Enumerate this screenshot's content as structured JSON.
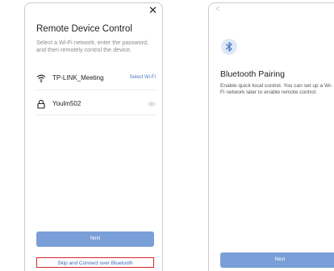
{
  "remote_control": {
    "close_icon": "close-icon",
    "title": "Remote Device Control",
    "description": "Select a Wi-Fi network, enter the password, and then remotely control the device.",
    "wifi": {
      "icon": "wifi-icon",
      "ssid": "TP-LINK_Meeting",
      "action": "Select Wi-Fi"
    },
    "password": {
      "icon": "lock-icon",
      "value": "Youlm502",
      "toggle_icon": "eye-icon"
    },
    "next_label": "Next",
    "skip_label": "Skip and Connect over Bluetooth",
    "colors": {
      "primary": "#7a9fd8",
      "link": "#3a67b7",
      "highlight": "#d3272c"
    }
  },
  "bluetooth_pairing": {
    "back_icon": "back-chevron-icon",
    "badge_icon": "bluetooth-icon",
    "title": "Bluetooth Pairing",
    "description": "Enable quick local control. You can set up a Wi-Fi network later to enable remote control.",
    "next_label": "Next",
    "colors": {
      "badge_bg": "#dfe8f6",
      "icon": "#4a78c2"
    }
  }
}
